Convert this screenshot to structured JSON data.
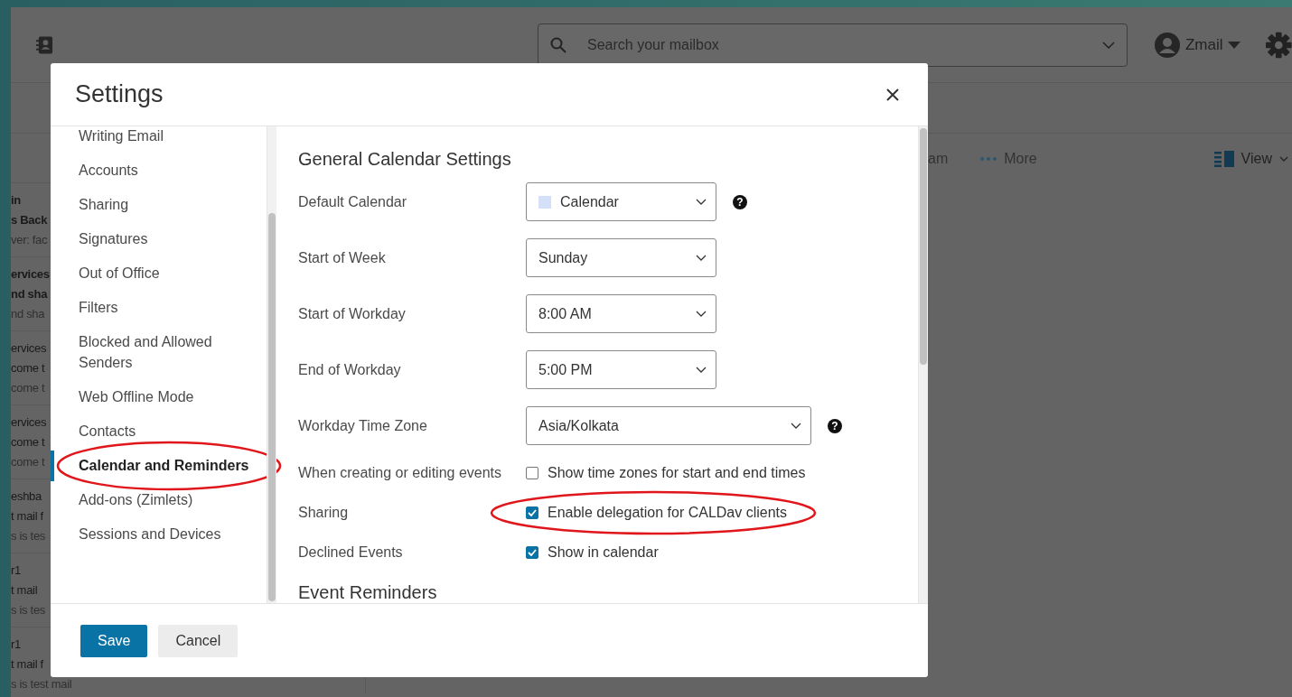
{
  "app": {
    "search": {
      "placeholder": "Search your mailbox"
    },
    "user": "Zmail",
    "toolbar": [
      {
        "kind": "text",
        "label": "am"
      },
      {
        "kind": "more",
        "label": "More"
      },
      {
        "kind": "view",
        "label": "View"
      }
    ],
    "messages": [
      {
        "unread": true,
        "lines": [
          "in",
          "s Back",
          "ver: fac"
        ]
      },
      {
        "unread": true,
        "lines": [
          "ervices",
          "nd sha",
          "nd sha"
        ]
      },
      {
        "unread": false,
        "lines": [
          "ervices",
          "come t",
          "come t"
        ]
      },
      {
        "unread": false,
        "lines": [
          "ervices",
          "come t",
          "come t"
        ]
      },
      {
        "unread": false,
        "lines": [
          "eshba",
          "t mail f",
          "s is tes"
        ]
      },
      {
        "unread": false,
        "lines": [
          "r1",
          "t mail",
          "s is tes"
        ]
      },
      {
        "unread": false,
        "lines": [
          "r1",
          "t mail f",
          "s is test mail"
        ]
      }
    ]
  },
  "dialog": {
    "title": "Settings",
    "nav": [
      {
        "label": "Writing Email",
        "selected": false,
        "annotated": false
      },
      {
        "label": "Accounts",
        "selected": false,
        "annotated": false
      },
      {
        "label": "Sharing",
        "selected": false,
        "annotated": false
      },
      {
        "label": "Signatures",
        "selected": false,
        "annotated": false
      },
      {
        "label": "Out of Office",
        "selected": false,
        "annotated": false
      },
      {
        "label": "Filters",
        "selected": false,
        "annotated": false
      },
      {
        "label": "Blocked and Allowed Senders",
        "selected": false,
        "annotated": false
      },
      {
        "label": "Web Offline Mode",
        "selected": false,
        "annotated": false
      },
      {
        "label": "Contacts",
        "selected": false,
        "annotated": false
      },
      {
        "label": "Calendar and Reminders",
        "selected": true,
        "annotated": true
      },
      {
        "label": "Add-ons (Zimlets)",
        "selected": false,
        "annotated": false
      },
      {
        "label": "Sessions and Devices",
        "selected": false,
        "annotated": false
      }
    ],
    "sections": [
      {
        "heading": "General Calendar Settings",
        "rows": [
          {
            "kind": "select",
            "label": "Default Calendar",
            "value": "Calendar",
            "color": "#d3e0f7",
            "help": "?"
          },
          {
            "kind": "select",
            "label": "Start of Week",
            "value": "Sunday"
          },
          {
            "kind": "select",
            "label": "Start of Workday",
            "value": "8:00 AM"
          },
          {
            "kind": "select",
            "label": "End of Workday",
            "value": "5:00 PM"
          },
          {
            "kind": "wideselect",
            "label": "Workday Time Zone",
            "value": "Asia/Kolkata",
            "help": "?"
          },
          {
            "kind": "checkbox",
            "label": "When creating or editing events",
            "text": "Show time zones for start and end times",
            "checked": false,
            "annotated": false
          },
          {
            "kind": "checkbox",
            "label": "Sharing",
            "text": "Enable delegation for CALDav clients",
            "checked": true,
            "annotated": true
          },
          {
            "kind": "checkbox",
            "label": "Declined Events",
            "text": "Show in calendar",
            "checked": true,
            "annotated": false
          }
        ]
      },
      {
        "heading": "Event Reminders"
      }
    ],
    "buttons": [
      {
        "kind": "primary",
        "label": "Save"
      },
      {
        "kind": "secondary",
        "label": "Cancel"
      }
    ]
  }
}
